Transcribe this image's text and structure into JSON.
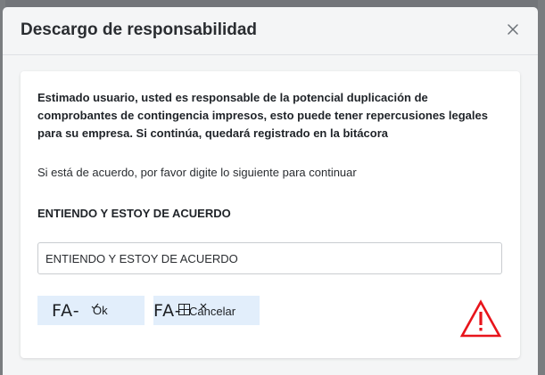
{
  "modal": {
    "title": "Descargo de responsabilidad",
    "close_icon": "close-icon"
  },
  "content": {
    "warning": "Estimado usuario, usted es responsable de la potencial duplicación de comprobantes de contingencia impresos, esto puede tener repercusiones legales para su empresa. Si continúa, quedará registrado en la bitácora",
    "instruction": "Si está de acuerdo, por favor digite lo siguiente para continuar",
    "phrase_label": "ENTIENDO Y ESTOY DE ACUERDO",
    "input_value": "ENTIENDO Y ESTOY DE ACUERDO"
  },
  "buttons": {
    "ok": {
      "fa_text": "FA-",
      "label": "Ok",
      "icon": "check-icon"
    },
    "cancel": {
      "fa_text": "FA-",
      "label": "Cancelar",
      "icon": "times-icon"
    }
  },
  "icons": {
    "warning_icon": "warning-triangle-icon",
    "warning_color": "#e8141b"
  },
  "colors": {
    "button_bg": "#e2eefb",
    "modal_bg": "#f4f5f6",
    "card_bg": "#ffffff"
  }
}
